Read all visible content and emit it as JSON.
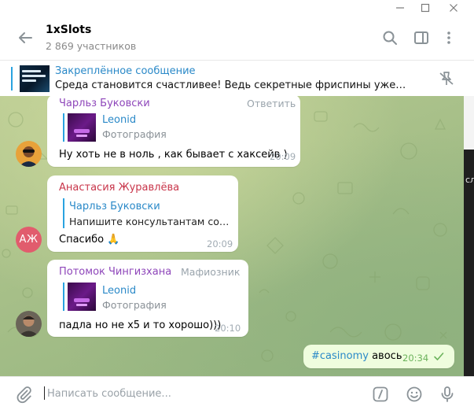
{
  "window": {
    "controls": {
      "minimize_icon": "minimize-icon",
      "maximize_icon": "maximize-icon",
      "close_icon": "close-icon"
    }
  },
  "header": {
    "title": "1xSlots",
    "subtitle": "2 869 участников",
    "icons": [
      "back-arrow-icon",
      "search-icon",
      "sidebar-toggle-icon",
      "more-vertical-icon"
    ]
  },
  "pinned": {
    "title": "Закреплённое сообщение",
    "text": "Среда становится счастливее!  Ведь секретные фриспины уже начислены...",
    "icon": "unpin-icon"
  },
  "messages": [
    {
      "sender": "Чарльз Буковски",
      "reply_label": "Ответить",
      "quote_name": "Leonid",
      "quote_text": "Фотография",
      "text": "Ну хоть не в ноль , как бывает с хаксейв )",
      "time": "20:09",
      "avatar": "photo"
    },
    {
      "sender": "Анастасия Журавлёва",
      "quote_name": "Чарльз Буковски",
      "quote_text": "Напишите консультантам со ск...",
      "text": "Спасибо 🙏",
      "time": "20:09",
      "avatar_initials": "АЖ"
    },
    {
      "sender": "Потомок Чингизхана",
      "badge": "Мафиозник",
      "quote_name": "Leonid",
      "quote_text": "Фотография",
      "text": "падла  но не х5 и то хорошо)))",
      "time": "20:10",
      "avatar": "photo"
    }
  ],
  "outgoing": {
    "hashtag": "#casinomy",
    "text": " авось",
    "time": "20:34",
    "status_icon": "read-check-icon"
  },
  "right_edge": {
    "text": "сл"
  },
  "composer": {
    "placeholder": "Написать сообщение...",
    "value": "",
    "icons": [
      "attach-icon",
      "bot-command-icon",
      "emoji-icon",
      "microphone-icon"
    ]
  },
  "colors": {
    "accent": "#2aa3e0",
    "sender_purple": "#8e46ba",
    "sender_red": "#c8354a",
    "outgoing_bubble": "#effdde",
    "avatar_aj": "#e15c6d"
  }
}
